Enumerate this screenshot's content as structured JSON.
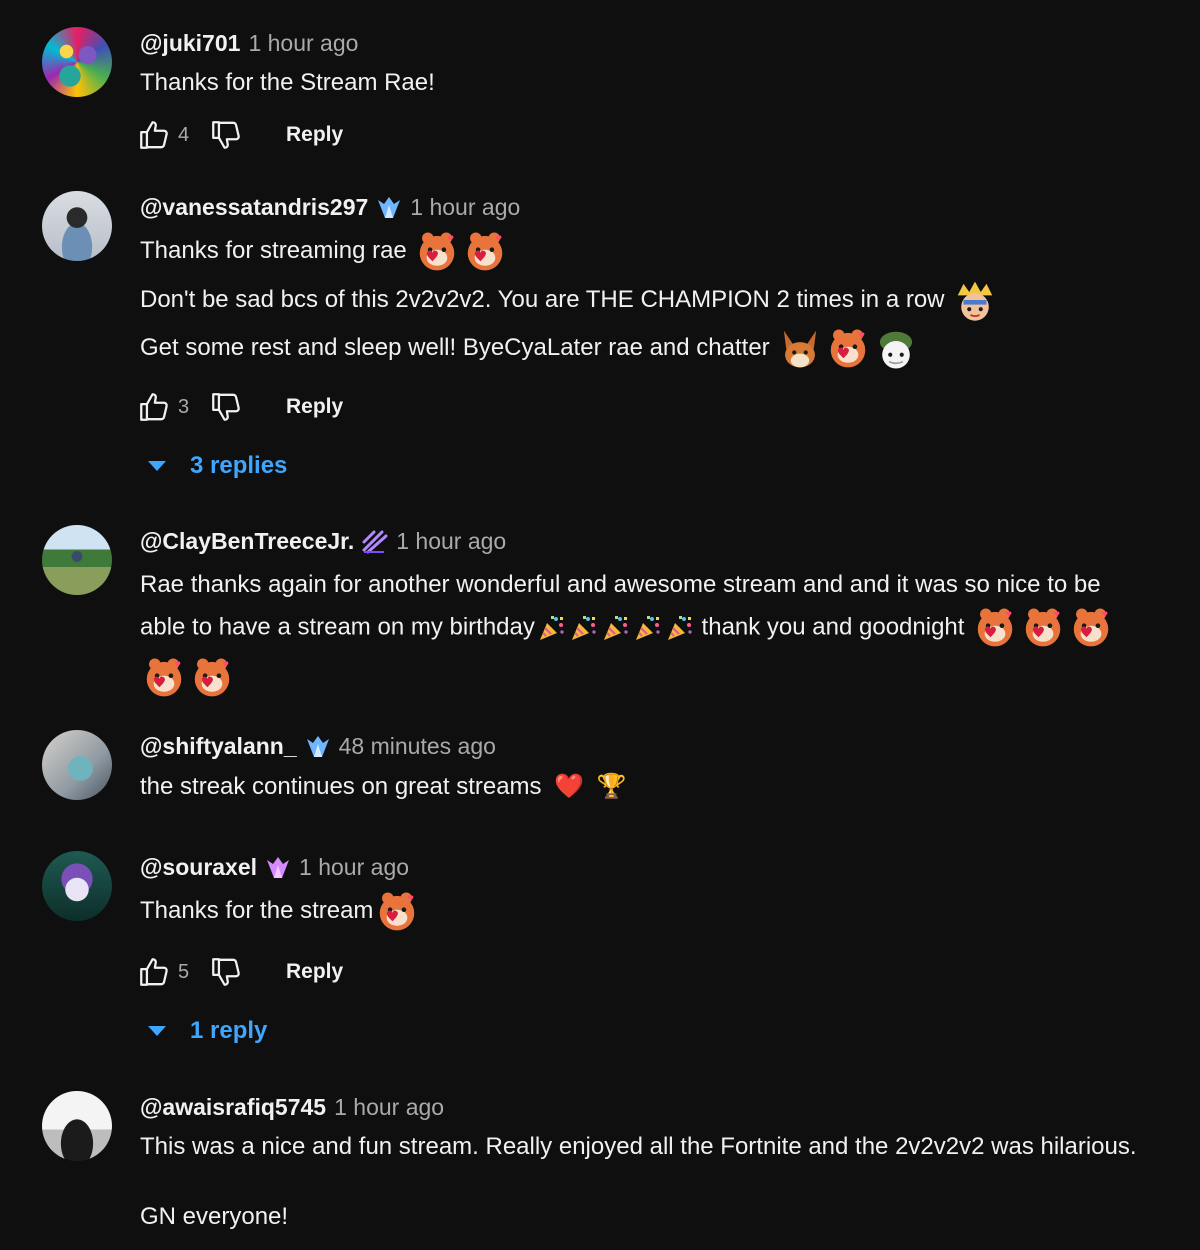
{
  "comments": [
    {
      "handle": "@juki701",
      "time": "1 hour ago",
      "text": "Thanks for the Stream Rae!",
      "likes": "4",
      "reply_label": "Reply"
    },
    {
      "handle": "@vanessatandris297",
      "time": "1 hour ago",
      "line1": "Thanks for streaming rae",
      "line2": "Don't be sad bcs of this 2v2v2v2. You are THE CHAMPION 2 times in a row",
      "line3": "Get some rest and sleep well! ByeCyaLater rae and chatter",
      "likes": "3",
      "reply_label": "Reply",
      "replies_label": "3 replies"
    },
    {
      "handle": "@ClayBenTreeceJr.",
      "time": "1 hour ago",
      "line1": "Rae thanks again for another wonderful and awesome stream and and it was so nice to be",
      "line2a": "able to have a stream on my birthday",
      "line2b": "thank you and goodnight"
    },
    {
      "handle": "@shiftyalann_",
      "time": "48 minutes ago",
      "text": "the streak continues on great streams",
      "emoji_heart": "❤️",
      "emoji_trophy": "🏆"
    },
    {
      "handle": "@souraxel",
      "time": "1 hour ago",
      "text": "Thanks for the stream",
      "likes": "5",
      "reply_label": "Reply",
      "replies_label": "1 reply"
    },
    {
      "handle": "@awaisrafiq5745",
      "time": "1 hour ago",
      "line1": "This was a nice and fun stream. Really enjoyed all the Fortnite and the 2v2v2v2 was hilarious.",
      "line2": "GN everyone!"
    }
  ],
  "colors": {
    "background": "#0f0f0f",
    "text": "#f1f1f1",
    "muted": "#aaaaaa",
    "link": "#3ea6ff"
  },
  "icons": [
    "thumbs-up-icon",
    "thumbs-down-icon",
    "chevron-down-icon",
    "member-badge-icon",
    "emote-heart-icon",
    "emote-party-icon",
    "emote-crown-icon",
    "emote-fox-icon",
    "emote-helmet-icon"
  ]
}
